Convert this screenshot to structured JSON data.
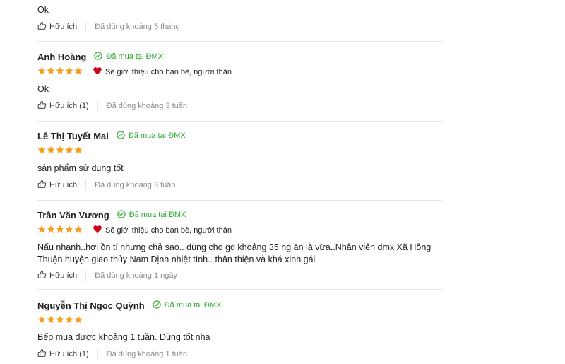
{
  "colors": {
    "star": "#f59e1c",
    "verified": "#2ba832",
    "heart": "#d0021b",
    "muted_text": "#8c8c8c"
  },
  "icons": {
    "star": "star-icon",
    "verified": "check-circle-icon",
    "heart": "heart-icon",
    "helpful": "thumbs-up-icon"
  },
  "reviews": [
    {
      "name": "",
      "verified": "",
      "stars": 0,
      "recommend": "",
      "comment": "Ok",
      "helpful": "Hữu ích",
      "usage": "Đã dùng khoảng 5 tháng"
    },
    {
      "name": "Anh Hoàng",
      "verified": "Đã mua tại ĐMX",
      "stars": 5,
      "recommend": "Sẽ giới thiệu cho bạn bè, người thân",
      "comment": "Ok",
      "helpful": "Hữu ích (1)",
      "usage": "Đã dùng khoảng 3 tuần"
    },
    {
      "name": "Lê Thị Tuyết Mai",
      "verified": "Đã mua tại ĐMX",
      "stars": 5,
      "recommend": "",
      "comment": "sản phẩm sử dụng tốt",
      "helpful": "Hữu ích",
      "usage": "Đã dùng khoảng 3 tuần"
    },
    {
      "name": "Trần Văn Vương",
      "verified": "Đã mua tại ĐMX",
      "stars": 5,
      "recommend": "Sẽ giới thiệu cho bạn bè, người thân",
      "comment": "Nấu nhanh..hơi ồn tí nhưng chả sao.. dùng cho gd khoảng 35 ng ăn là vừa..Nhân viên dmx Xã Hồng Thuận huyện giao thủy Nam Định nhiệt tình.. thân thiện và khá xinh gái",
      "helpful": "Hữu ích",
      "usage": "Đã dùng khoảng 1 ngày"
    },
    {
      "name": "Nguyễn Thị Ngọc Quỳnh",
      "verified": "Đã mua tại ĐMX",
      "stars": 5,
      "recommend": "",
      "comment": "Bếp mua được khoảng 1 tuần. Dùng tốt nha",
      "helpful": "Hữu ích (1)",
      "usage": "Đã dùng khoảng 1 tuần"
    }
  ]
}
